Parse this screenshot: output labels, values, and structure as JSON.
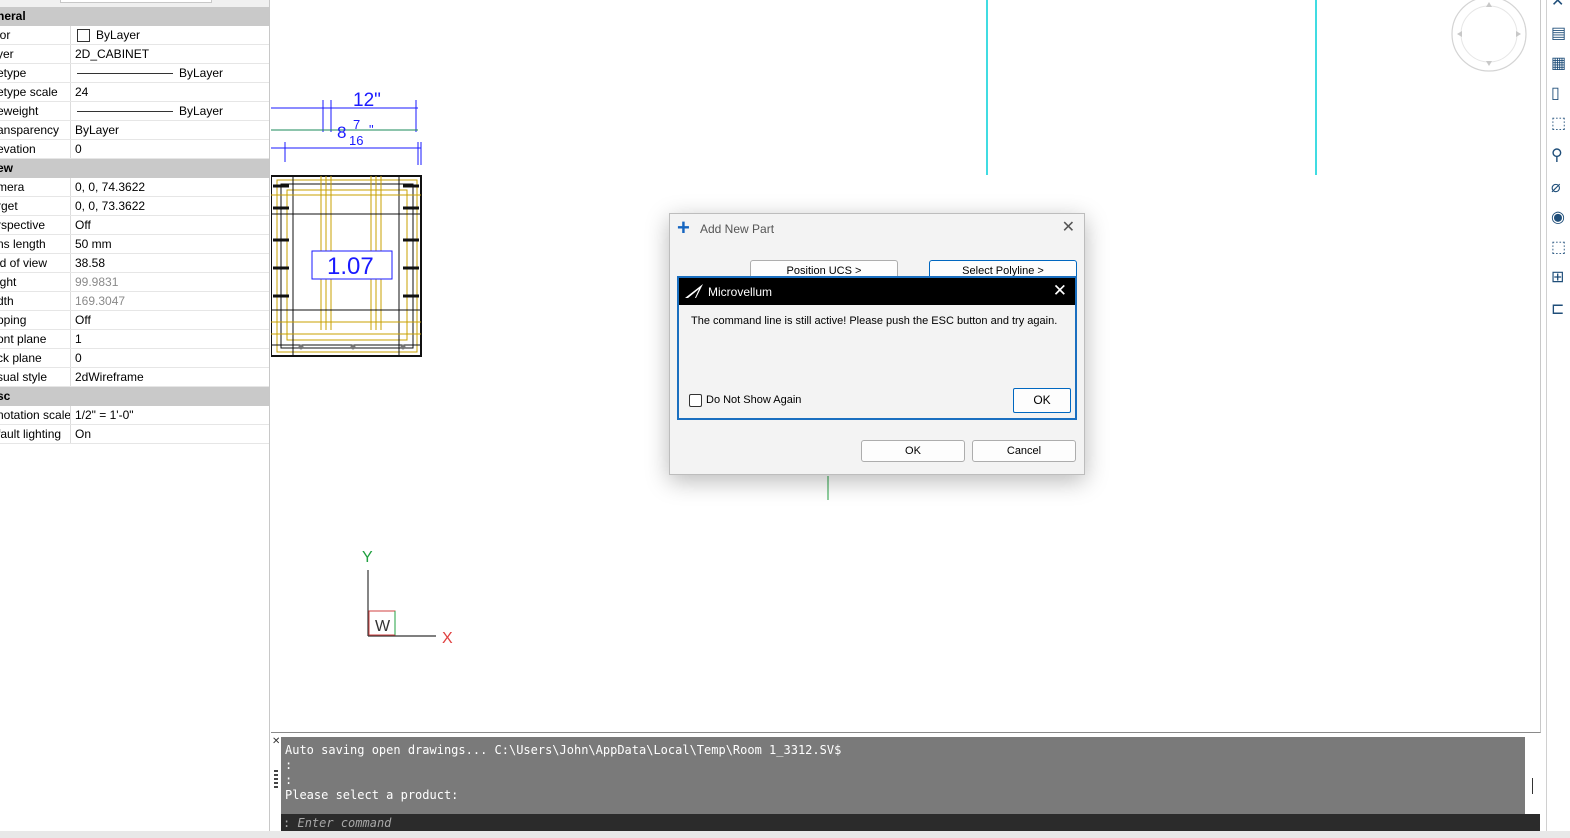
{
  "properties": {
    "sections": [
      {
        "title": "neral",
        "rows": [
          {
            "name": "lor",
            "value": "ByLayer",
            "kind": "swatch"
          },
          {
            "name": "yer",
            "value": "2D_CABINET"
          },
          {
            "name": "etype",
            "value": "ByLayer",
            "kind": "linetype"
          },
          {
            "name": "etype scale",
            "value": "24"
          },
          {
            "name": "eweight",
            "value": "ByLayer",
            "kind": "linetype"
          },
          {
            "name": "ansparency",
            "value": "ByLayer"
          },
          {
            "name": "evation",
            "value": "0"
          }
        ]
      },
      {
        "title": "ew",
        "rows": [
          {
            "name": "mera",
            "value": "0, 0, 74.3622"
          },
          {
            "name": "rget",
            "value": "0, 0, 73.3622"
          },
          {
            "name": "rspective",
            "value": "Off"
          },
          {
            "name": "ns length",
            "value": "50 mm"
          },
          {
            "name": "ld of view",
            "value": "38.58"
          },
          {
            "name": "ight",
            "value": "99.9831",
            "gray": true
          },
          {
            "name": "dth",
            "value": "169.3047",
            "gray": true
          },
          {
            "name": "pping",
            "value": "Off"
          },
          {
            "name": "ont plane",
            "value": "1"
          },
          {
            "name": "ck plane",
            "value": "0"
          },
          {
            "name": "sual style",
            "value": "2dWireframe"
          }
        ]
      },
      {
        "title": "sc",
        "rows": [
          {
            "name": "notation scale",
            "value": "1/2\" = 1'-0\""
          },
          {
            "name": "fault lighting",
            "value": "On"
          }
        ]
      }
    ]
  },
  "drawing": {
    "dim_top": "12\"",
    "dim_inner_whole": "8",
    "dim_inner_num": "7",
    "dim_inner_den": "16",
    "dim_inner_inch": "\"",
    "cabinet_label": "1.07",
    "ucs_y": "Y",
    "ucs_x": "X",
    "ucs_w": "W"
  },
  "add_part_dialog": {
    "title": "Add New Part",
    "position_ucs": "Position UCS >",
    "select_polyline": "Select Polyline >",
    "ok": "OK",
    "cancel": "Cancel"
  },
  "message_box": {
    "title": "Microvellum",
    "message": "The command line is still active! Please push the ESC button and try again.",
    "do_not_show": "Do Not Show Again",
    "ok": "OK"
  },
  "command_line": {
    "history": [
      "Auto saving open drawings... C:\\Users\\John\\AppData\\Local\\Temp\\Room 1_3312.SV$",
      ":",
      ":",
      "Please select a product:"
    ],
    "prompt": ":",
    "placeholder": "Enter command"
  },
  "colors": {
    "accent": "#0067c0",
    "dimension": "#1a1aff",
    "cabinet": "#c8a000",
    "cyan": "#00d0d8"
  }
}
